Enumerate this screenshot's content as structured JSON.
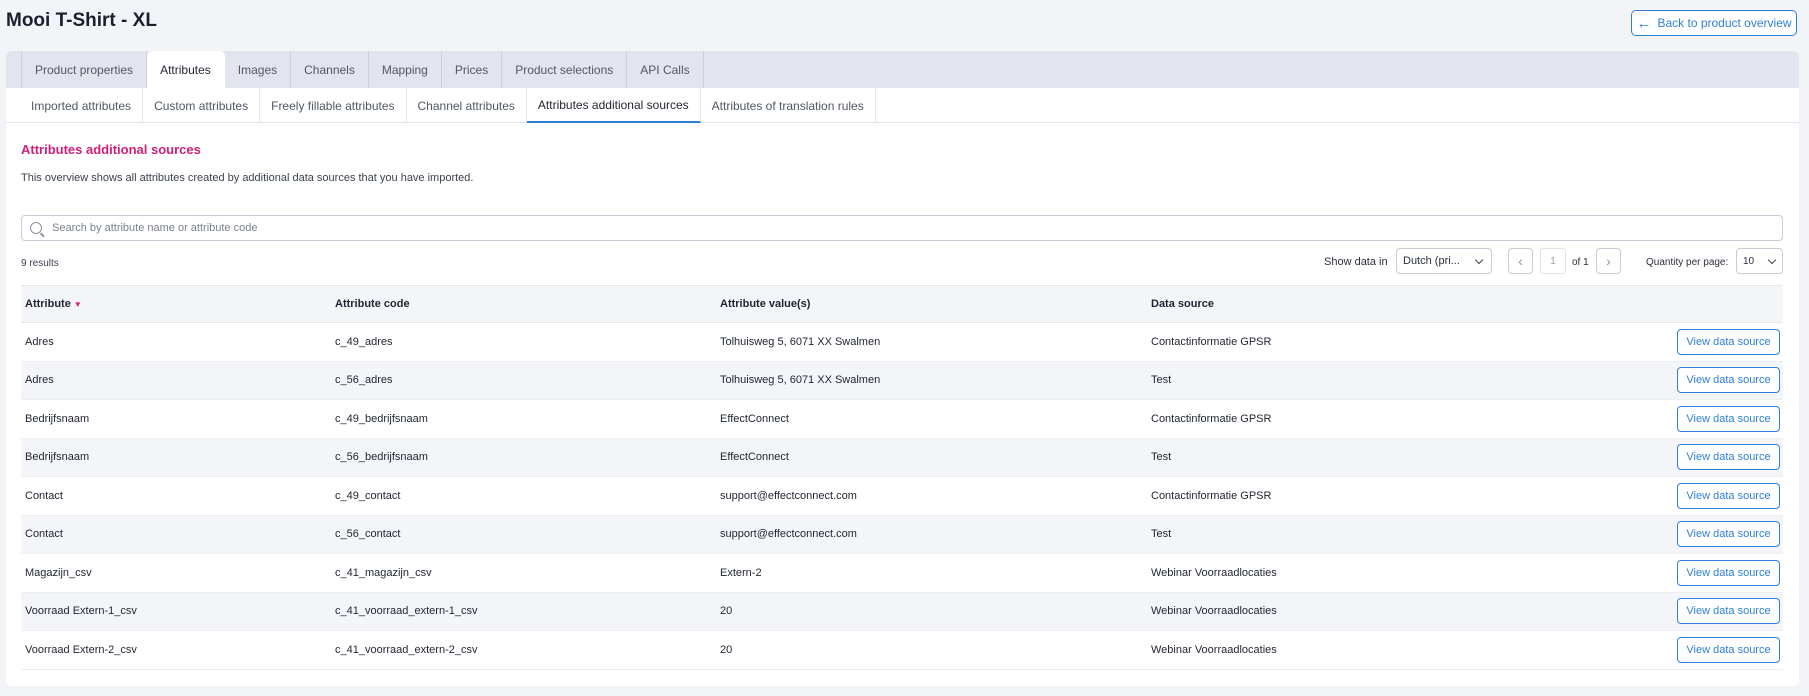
{
  "header": {
    "title": "Mooi T-Shirt - XL",
    "back_label": "Back to product overview"
  },
  "main_tabs": [
    {
      "label": "Product properties"
    },
    {
      "label": "Attributes"
    },
    {
      "label": "Images"
    },
    {
      "label": "Channels"
    },
    {
      "label": "Mapping"
    },
    {
      "label": "Prices"
    },
    {
      "label": "Product selections"
    },
    {
      "label": "API Calls"
    }
  ],
  "sub_tabs": [
    {
      "label": "Imported attributes"
    },
    {
      "label": "Custom attributes"
    },
    {
      "label": "Freely fillable attributes"
    },
    {
      "label": "Channel attributes"
    },
    {
      "label": "Attributes additional sources"
    },
    {
      "label": "Attributes of translation rules"
    }
  ],
  "section": {
    "title": "Attributes additional sources",
    "description": "This overview shows all attributes created by additional data sources that you have imported."
  },
  "search": {
    "placeholder": "Search by attribute name or attribute code",
    "value": ""
  },
  "toolbar": {
    "results": "9 results",
    "show_data_label": "Show data in",
    "language_value": "Dutch (pri...",
    "page_value": "1",
    "of_label": "of 1",
    "qty_label": "Quantity per page:",
    "qty_value": "10"
  },
  "table": {
    "headers": {
      "attribute": "Attribute",
      "code": "Attribute code",
      "value": "Attribute value(s)",
      "source": "Data source"
    },
    "action_label": "View data source",
    "rows": [
      {
        "attribute": "Adres",
        "code": "c_49_adres",
        "value": "Tolhuisweg 5, 6071 XX Swalmen",
        "source": "Contactinformatie GPSR"
      },
      {
        "attribute": "Adres",
        "code": "c_56_adres",
        "value": "Tolhuisweg 5, 6071 XX Swalmen",
        "source": "Test"
      },
      {
        "attribute": "Bedrijfsnaam",
        "code": "c_49_bedrijfsnaam",
        "value": "EffectConnect",
        "source": "Contactinformatie GPSR"
      },
      {
        "attribute": "Bedrijfsnaam",
        "code": "c_56_bedrijfsnaam",
        "value": "EffectConnect",
        "source": "Test"
      },
      {
        "attribute": "Contact",
        "code": "c_49_contact",
        "value": "support@effectconnect.com",
        "source": "Contactinformatie GPSR"
      },
      {
        "attribute": "Contact",
        "code": "c_56_contact",
        "value": "support@effectconnect.com",
        "source": "Test"
      },
      {
        "attribute": "Magazijn_csv",
        "code": "c_41_magazijn_csv",
        "value": "Extern-2",
        "source": "Webinar Voorraadlocaties"
      },
      {
        "attribute": "Voorraad Extern-1_csv",
        "code": "c_41_voorraad_extern-1_csv",
        "value": "20",
        "source": "Webinar Voorraadlocaties"
      },
      {
        "attribute": "Voorraad Extern-2_csv",
        "code": "c_41_voorraad_extern-2_csv",
        "value": "20",
        "source": "Webinar Voorraadlocaties"
      }
    ]
  },
  "colors": {
    "accent": "#2f7fd8",
    "section_title": "#cf1f77"
  },
  "icons": {
    "back": "arrow-left-icon",
    "search": "search-icon",
    "prev": "chevron-left-icon",
    "next": "chevron-right-icon",
    "dropdown": "chevron-down-icon",
    "sort": "sort-down-icon"
  }
}
